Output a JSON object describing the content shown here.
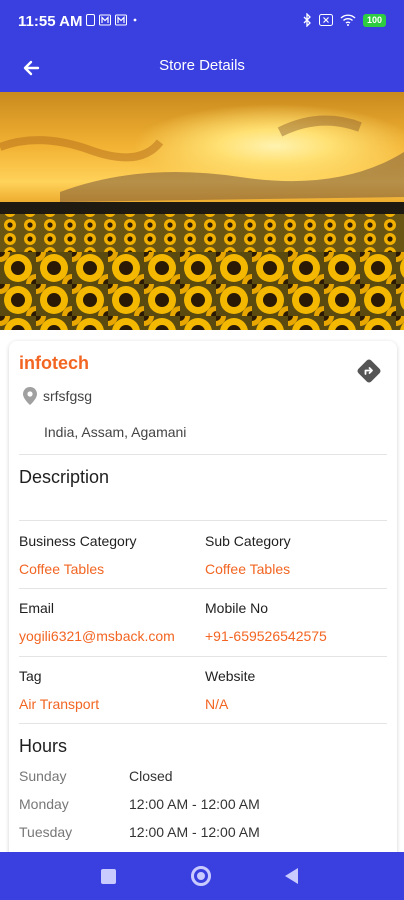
{
  "status_bar": {
    "time": "11:55 AM",
    "left_icons": [
      "sim-icon",
      "m-icon",
      "m-icon",
      "dot-icon"
    ],
    "right_icons": [
      "bluetooth-icon",
      "close-box-icon",
      "wifi-icon"
    ],
    "battery": "100"
  },
  "app_bar": {
    "title": "Store Details",
    "back_icon": "arrow-left-icon"
  },
  "hero_image": {
    "description_icon": "sunflower-field-image"
  },
  "store": {
    "name": "infotech",
    "location_label": "srfsfgsg",
    "address": "India, Assam, Agamani",
    "direction_icon": "directions-icon"
  },
  "details": {
    "description_heading": "Description",
    "description_text": "",
    "fields": [
      {
        "label": "Business Category",
        "value": "Coffee Tables"
      },
      {
        "label": "Sub Category",
        "value": "Coffee Tables"
      },
      {
        "label": "Email",
        "value": "yogili6321@msback.com"
      },
      {
        "label": "Mobile No",
        "value": "+91-659526542575"
      },
      {
        "label": "Tag",
        "value": "Air Transport"
      },
      {
        "label": "Website",
        "value": "N/A"
      }
    ]
  },
  "hours": {
    "heading": "Hours",
    "rows": [
      {
        "day": "Sunday",
        "time": "Closed"
      },
      {
        "day": "Monday",
        "time": "12:00 AM - 12:00 AM"
      },
      {
        "day": "Tuesday",
        "time": "12:00 AM - 12:00 AM"
      }
    ]
  },
  "colors": {
    "primary": "#3a3fe0",
    "accent": "#f26522"
  }
}
